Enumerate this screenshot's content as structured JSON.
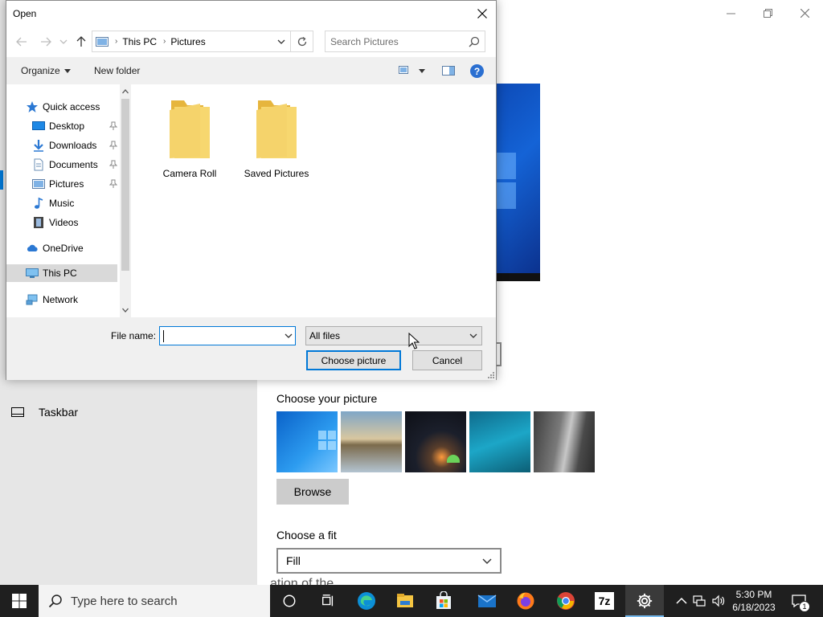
{
  "settings": {
    "nav_taskbar": "Taskbar",
    "choose_picture_label": "Choose your picture",
    "browse_label": "Browse",
    "choose_fit_label": "Choose a fit",
    "fit_value": "Fill",
    "clipped_text": "ation of the"
  },
  "dialog": {
    "title": "Open",
    "breadcrumb": [
      "This PC",
      "Pictures"
    ],
    "search_placeholder": "Search Pictures",
    "toolbar": {
      "organize": "Organize",
      "new_folder": "New folder"
    },
    "nav_items": [
      {
        "label": "Quick access",
        "icon": "star-icon"
      },
      {
        "label": "Desktop",
        "icon": "desktop-icon",
        "pinned": true
      },
      {
        "label": "Downloads",
        "icon": "download-arrow-icon",
        "pinned": true
      },
      {
        "label": "Documents",
        "icon": "document-icon",
        "pinned": true
      },
      {
        "label": "Pictures",
        "icon": "pictures-icon",
        "pinned": true
      },
      {
        "label": "Music",
        "icon": "music-note-icon"
      },
      {
        "label": "Videos",
        "icon": "film-icon"
      },
      {
        "label": "OneDrive",
        "icon": "cloud-icon"
      },
      {
        "label": "This PC",
        "icon": "computer-icon",
        "selected": true
      },
      {
        "label": "Network",
        "icon": "network-icon"
      }
    ],
    "folders": [
      {
        "name": "Camera Roll"
      },
      {
        "name": "Saved Pictures"
      }
    ],
    "file_name_label": "File name:",
    "file_name_value": "",
    "file_type": "All files",
    "open_button": "Choose picture",
    "cancel_button": "Cancel"
  },
  "taskbar": {
    "search_placeholder": "Type here to search",
    "apps": [
      "cortana-icon",
      "task-view-icon",
      "edge-icon",
      "file-explorer-icon",
      "store-icon",
      "mail-icon",
      "firefox-icon",
      "chrome-icon",
      "7zip-icon",
      "settings-gear-icon"
    ],
    "active_app": "settings-gear-icon",
    "sevenzip_label": "7z",
    "time": "5:30 PM",
    "date": "6/18/2023",
    "notification_count": "1"
  },
  "colors": {
    "accent": "#0078d7",
    "taskbar": "#1f1f1f",
    "folder": "#f5d36b"
  }
}
